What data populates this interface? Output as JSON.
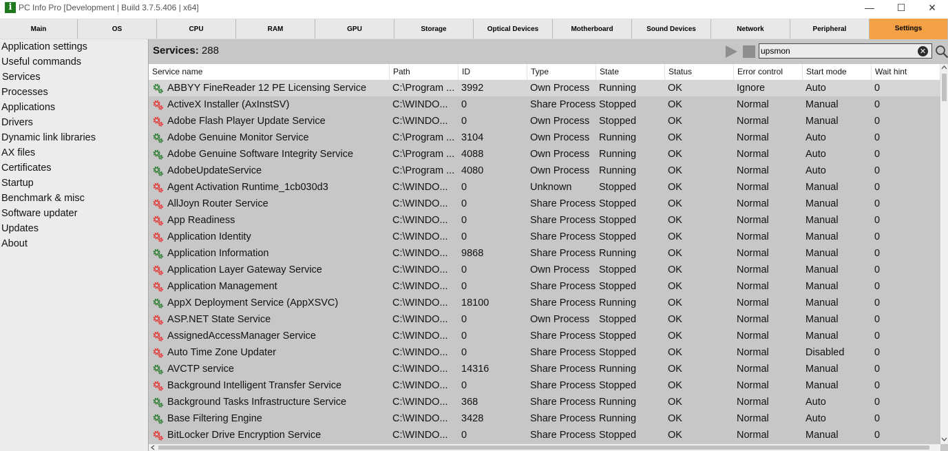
{
  "window": {
    "title": "PC Info Pro [Development | Build 3.7.5.406 | x64]",
    "app_icon": "i",
    "controls": {
      "minimize": "—",
      "maximize": "☐",
      "close": "✕"
    }
  },
  "tabs": [
    {
      "label": "Main"
    },
    {
      "label": "OS"
    },
    {
      "label": "CPU"
    },
    {
      "label": "RAM"
    },
    {
      "label": "GPU"
    },
    {
      "label": "Storage"
    },
    {
      "label": "Optical Devices"
    },
    {
      "label": "Motherboard"
    },
    {
      "label": "Sound Devices"
    },
    {
      "label": "Network"
    },
    {
      "label": "Peripheral"
    },
    {
      "label": "Settings"
    }
  ],
  "active_tab": "Settings",
  "sidebar": {
    "items": [
      {
        "label": "Application settings"
      },
      {
        "label": "Useful commands"
      },
      {
        "label": "Services"
      },
      {
        "label": "Processes"
      },
      {
        "label": "Applications"
      },
      {
        "label": "Drivers"
      },
      {
        "label": "Dynamic link libraries"
      },
      {
        "label": "AX files"
      },
      {
        "label": "Certificates"
      },
      {
        "label": "Startup"
      },
      {
        "label": "Benchmark & misc"
      },
      {
        "label": "Software updater"
      },
      {
        "label": "Updates"
      },
      {
        "label": "About"
      }
    ]
  },
  "services": {
    "label": "Services:",
    "count": "288",
    "search_value": "upsmon",
    "columns": [
      "Service name",
      "Path",
      "ID",
      "Type",
      "State",
      "Status",
      "Error control",
      "Start mode",
      "Wait hint"
    ],
    "rows": [
      {
        "name": "ABBYY FineReader 12 PE Licensing Service",
        "path": "C:\\Program ...",
        "id": "3992",
        "type": "Own Process",
        "state": "Running",
        "status": "OK",
        "error": "Ignore",
        "start": "Auto",
        "wait": "0"
      },
      {
        "name": "ActiveX Installer (AxInstSV)",
        "path": "C:\\WINDO...",
        "id": "0",
        "type": "Share Process",
        "state": "Stopped",
        "status": "OK",
        "error": "Normal",
        "start": "Manual",
        "wait": "0"
      },
      {
        "name": "Adobe Flash Player Update Service",
        "path": "C:\\WINDO...",
        "id": "0",
        "type": "Own Process",
        "state": "Stopped",
        "status": "OK",
        "error": "Normal",
        "start": "Manual",
        "wait": "0"
      },
      {
        "name": "Adobe Genuine Monitor Service",
        "path": "C:\\Program ...",
        "id": "3104",
        "type": "Own Process",
        "state": "Running",
        "status": "OK",
        "error": "Normal",
        "start": "Auto",
        "wait": "0"
      },
      {
        "name": "Adobe Genuine Software Integrity Service",
        "path": "C:\\Program ...",
        "id": "4088",
        "type": "Own Process",
        "state": "Running",
        "status": "OK",
        "error": "Normal",
        "start": "Auto",
        "wait": "0"
      },
      {
        "name": "AdobeUpdateService",
        "path": "C:\\Program ...",
        "id": "4080",
        "type": "Own Process",
        "state": "Running",
        "status": "OK",
        "error": "Normal",
        "start": "Auto",
        "wait": "0"
      },
      {
        "name": "Agent Activation Runtime_1cb030d3",
        "path": "C:\\WINDO...",
        "id": "0",
        "type": "Unknown",
        "state": "Stopped",
        "status": "OK",
        "error": "Normal",
        "start": "Manual",
        "wait": "0"
      },
      {
        "name": "AllJoyn Router Service",
        "path": "C:\\WINDO...",
        "id": "0",
        "type": "Share Process",
        "state": "Stopped",
        "status": "OK",
        "error": "Normal",
        "start": "Manual",
        "wait": "0"
      },
      {
        "name": "App Readiness",
        "path": "C:\\WINDO...",
        "id": "0",
        "type": "Share Process",
        "state": "Stopped",
        "status": "OK",
        "error": "Normal",
        "start": "Manual",
        "wait": "0"
      },
      {
        "name": "Application Identity",
        "path": "C:\\WINDO...",
        "id": "0",
        "type": "Share Process",
        "state": "Stopped",
        "status": "OK",
        "error": "Normal",
        "start": "Manual",
        "wait": "0"
      },
      {
        "name": "Application Information",
        "path": "C:\\WINDO...",
        "id": "9868",
        "type": "Share Process",
        "state": "Running",
        "status": "OK",
        "error": "Normal",
        "start": "Manual",
        "wait": "0"
      },
      {
        "name": "Application Layer Gateway Service",
        "path": "C:\\WINDO...",
        "id": "0",
        "type": "Own Process",
        "state": "Stopped",
        "status": "OK",
        "error": "Normal",
        "start": "Manual",
        "wait": "0"
      },
      {
        "name": "Application Management",
        "path": "C:\\WINDO...",
        "id": "0",
        "type": "Share Process",
        "state": "Stopped",
        "status": "OK",
        "error": "Normal",
        "start": "Manual",
        "wait": "0"
      },
      {
        "name": "AppX Deployment Service (AppXSVC)",
        "path": "C:\\WINDO...",
        "id": "18100",
        "type": "Share Process",
        "state": "Running",
        "status": "OK",
        "error": "Normal",
        "start": "Manual",
        "wait": "0"
      },
      {
        "name": "ASP.NET State Service",
        "path": "C:\\WINDO...",
        "id": "0",
        "type": "Own Process",
        "state": "Stopped",
        "status": "OK",
        "error": "Normal",
        "start": "Manual",
        "wait": "0"
      },
      {
        "name": "AssignedAccessManager Service",
        "path": "C:\\WINDO...",
        "id": "0",
        "type": "Share Process",
        "state": "Stopped",
        "status": "OK",
        "error": "Normal",
        "start": "Manual",
        "wait": "0"
      },
      {
        "name": "Auto Time Zone Updater",
        "path": "C:\\WINDO...",
        "id": "0",
        "type": "Share Process",
        "state": "Stopped",
        "status": "OK",
        "error": "Normal",
        "start": "Disabled",
        "wait": "0"
      },
      {
        "name": "AVCTP service",
        "path": "C:\\WINDO...",
        "id": "14316",
        "type": "Share Process",
        "state": "Running",
        "status": "OK",
        "error": "Normal",
        "start": "Manual",
        "wait": "0"
      },
      {
        "name": "Background Intelligent Transfer Service",
        "path": "C:\\WINDO...",
        "id": "0",
        "type": "Share Process",
        "state": "Stopped",
        "status": "OK",
        "error": "Normal",
        "start": "Manual",
        "wait": "0"
      },
      {
        "name": "Background Tasks Infrastructure Service",
        "path": "C:\\WINDO...",
        "id": "368",
        "type": "Share Process",
        "state": "Running",
        "status": "OK",
        "error": "Normal",
        "start": "Auto",
        "wait": "0"
      },
      {
        "name": "Base Filtering Engine",
        "path": "C:\\WINDO...",
        "id": "3428",
        "type": "Share Process",
        "state": "Running",
        "status": "OK",
        "error": "Normal",
        "start": "Auto",
        "wait": "0"
      },
      {
        "name": "BitLocker Drive Encryption Service",
        "path": "C:\\WINDO...",
        "id": "0",
        "type": "Share Process",
        "state": "Stopped",
        "status": "OK",
        "error": "Normal",
        "start": "Manual",
        "wait": "0"
      }
    ]
  },
  "colors": {
    "accent_tab": "#f5a145",
    "running_gear": "#2e7d32",
    "stopped_gear": "#e53935",
    "table_bg": "#c7c7c7"
  },
  "icons": {
    "app": "app-logo-icon",
    "play": "play-icon",
    "stop": "stop-icon",
    "clear": "clear-search-icon",
    "search": "search-icon",
    "running": "gear-running-icon",
    "stopped": "gear-stopped-icon",
    "sort": "sort-ascending-icon"
  }
}
